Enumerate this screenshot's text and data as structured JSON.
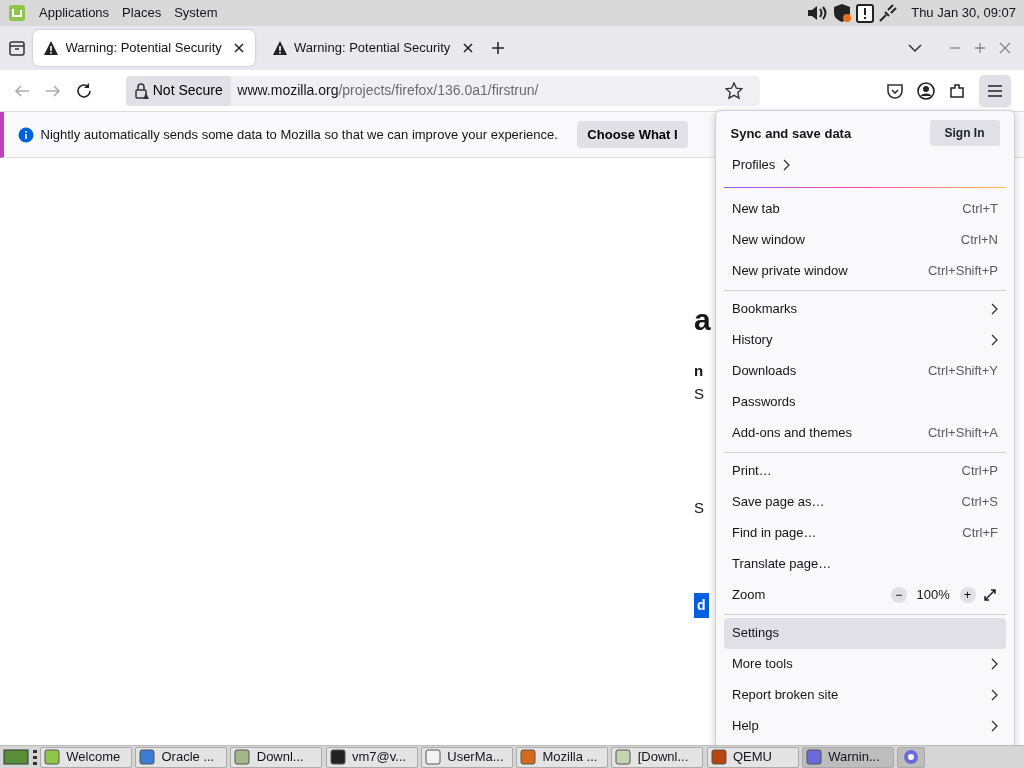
{
  "top_panel": {
    "menus": [
      "Applications",
      "Places",
      "System"
    ],
    "clock": "Thu Jan 30, 09:07"
  },
  "tabs": [
    {
      "title": "Warning: Potential Security",
      "selected": true
    },
    {
      "title": "Warning: Potential Security",
      "selected": false
    }
  ],
  "toolbar": {
    "security_label": "Not Secure",
    "url_host": "www.mozilla.org",
    "url_path": "/projects/firefox/136.0a1/firstrun/"
  },
  "notification": {
    "message": "Nightly automatically sends some data to Mozilla so that we can improve your experience.",
    "button": "Choose What I"
  },
  "page_fragments": [
    {
      "text": "a",
      "kind": "heading"
    },
    {
      "text": "n",
      "kind": "bold"
    },
    {
      "text": "S",
      "kind": "text"
    },
    {
      "text": "S",
      "kind": "text"
    },
    {
      "text": "d",
      "kind": "button"
    }
  ],
  "menu": {
    "sync_title": "Sync and save data",
    "sign_in": "Sign In",
    "profiles": "Profiles",
    "sections": [
      [
        {
          "kind": "item",
          "label": "New tab",
          "shortcut": "Ctrl+T",
          "submenu": false,
          "highlighted": false
        },
        {
          "kind": "item",
          "label": "New window",
          "shortcut": "Ctrl+N",
          "submenu": false,
          "highlighted": false
        },
        {
          "kind": "item",
          "label": "New private window",
          "shortcut": "Ctrl+Shift+P",
          "submenu": false,
          "highlighted": false
        }
      ],
      [
        {
          "kind": "item",
          "label": "Bookmarks",
          "submenu": true,
          "highlighted": false
        },
        {
          "kind": "item",
          "label": "History",
          "submenu": true,
          "highlighted": false
        },
        {
          "kind": "item",
          "label": "Downloads",
          "shortcut": "Ctrl+Shift+Y",
          "submenu": false,
          "highlighted": false
        },
        {
          "kind": "item",
          "label": "Passwords",
          "submenu": false,
          "highlighted": false
        },
        {
          "kind": "item",
          "label": "Add-ons and themes",
          "shortcut": "Ctrl+Shift+A",
          "submenu": false,
          "highlighted": false
        }
      ],
      [
        {
          "kind": "item",
          "label": "Print…",
          "shortcut": "Ctrl+P",
          "submenu": false,
          "highlighted": false
        },
        {
          "kind": "item",
          "label": "Save page as…",
          "shortcut": "Ctrl+S",
          "submenu": false,
          "highlighted": false
        },
        {
          "kind": "item",
          "label": "Find in page…",
          "shortcut": "Ctrl+F",
          "submenu": false,
          "highlighted": false
        },
        {
          "kind": "item",
          "label": "Translate page…",
          "submenu": false,
          "highlighted": false
        },
        {
          "kind": "zoom",
          "label": "Zoom",
          "value": "100%",
          "minus": "−",
          "plus": "+"
        }
      ],
      [
        {
          "kind": "item",
          "label": "Settings",
          "submenu": false,
          "highlighted": true
        },
        {
          "kind": "item",
          "label": "More tools",
          "submenu": true,
          "highlighted": false
        },
        {
          "kind": "item",
          "label": "Report broken site",
          "submenu": true,
          "highlighted": false
        },
        {
          "kind": "item",
          "label": "Help",
          "submenu": true,
          "highlighted": false
        }
      ]
    ]
  },
  "taskbar": [
    {
      "label": "Welcome",
      "selected": false
    },
    {
      "label": "Oracle ...",
      "selected": false
    },
    {
      "label": "Downl...",
      "selected": false
    },
    {
      "label": "vm7@v...",
      "selected": false
    },
    {
      "label": "UserMa...",
      "selected": false
    },
    {
      "label": "Mozilla ...",
      "selected": false
    },
    {
      "label": "[Downl...",
      "selected": false
    },
    {
      "label": "QEMU",
      "selected": false
    },
    {
      "label": "Warnin...",
      "selected": true
    }
  ]
}
